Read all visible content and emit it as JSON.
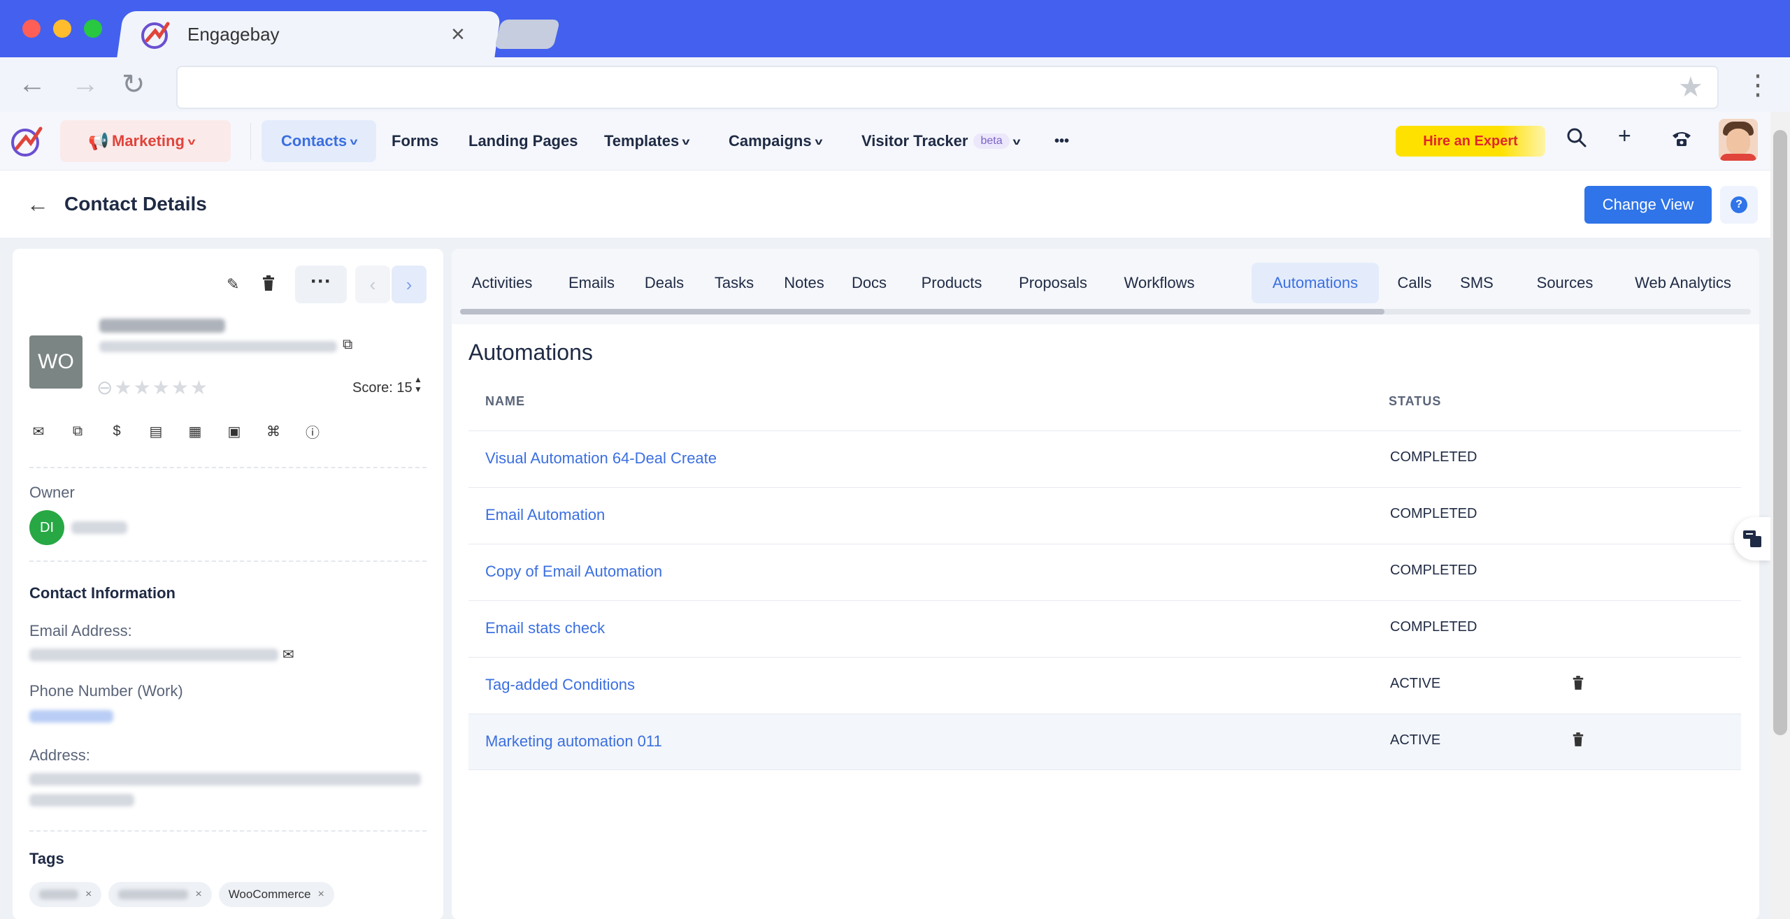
{
  "browser": {
    "tab_title": "Engagebay",
    "tab_close": "×",
    "url": ""
  },
  "header": {
    "marketing_label": "Marketing",
    "nav": [
      {
        "label": "Contacts"
      },
      {
        "label": "Forms"
      },
      {
        "label": "Landing Pages"
      },
      {
        "label": "Templates"
      },
      {
        "label": "Campaigns"
      },
      {
        "label": "Visitor Tracker"
      }
    ],
    "beta_badge": "beta",
    "more": "•••",
    "hire_expert": "Hire an Expert"
  },
  "page": {
    "title": "Contact Details",
    "change_view": "Change View",
    "help": "?"
  },
  "contact": {
    "initials": "WO",
    "score_label": "Score: 15",
    "owner_label": "Owner",
    "owner_initials": "DI",
    "contact_info_title": "Contact Information",
    "email_label": "Email Address:",
    "phone_label": "Phone Number (Work)",
    "address_label": "Address:",
    "tags_title": "Tags",
    "tags": [
      {
        "label": "WooCommerce"
      }
    ]
  },
  "tabs": [
    {
      "label": "Activities"
    },
    {
      "label": "Emails"
    },
    {
      "label": "Deals"
    },
    {
      "label": "Tasks"
    },
    {
      "label": "Notes"
    },
    {
      "label": "Docs"
    },
    {
      "label": "Products"
    },
    {
      "label": "Proposals"
    },
    {
      "label": "Workflows"
    },
    {
      "label": "Automations"
    },
    {
      "label": "Calls"
    },
    {
      "label": "SMS"
    },
    {
      "label": "Sources"
    },
    {
      "label": "Web Analytics"
    }
  ],
  "automations": {
    "title": "Automations",
    "columns": {
      "name": "NAME",
      "status": "STATUS"
    },
    "rows": [
      {
        "name": "Visual Automation 64-Deal Create",
        "status": "COMPLETED"
      },
      {
        "name": "Email Automation",
        "status": "COMPLETED"
      },
      {
        "name": "Copy of Email Automation",
        "status": "COMPLETED"
      },
      {
        "name": "Email stats check",
        "status": "COMPLETED"
      },
      {
        "name": "Tag-added Conditions",
        "status": "ACTIVE"
      },
      {
        "name": "Marketing automation 011",
        "status": "ACTIVE"
      }
    ]
  }
}
